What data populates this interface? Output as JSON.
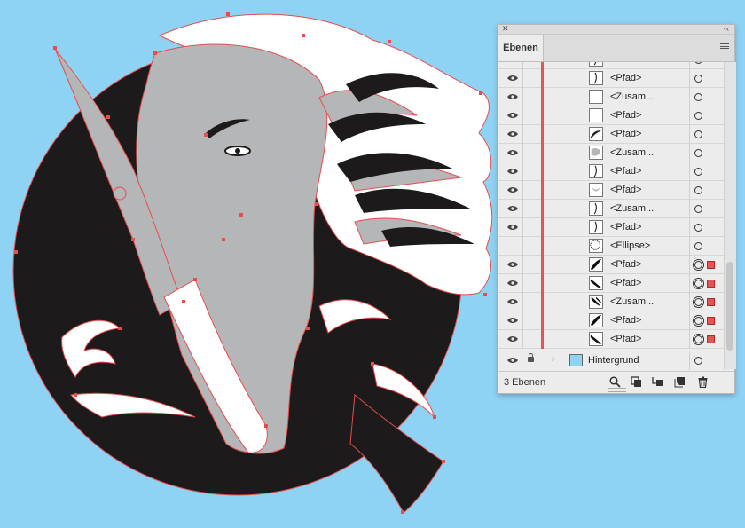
{
  "panel": {
    "tab_label": "Ebenen",
    "footer_label": "3 Ebenen"
  },
  "layers": [
    {
      "label": "<Pfad>",
      "thumb": "stroke-curve",
      "target": "single",
      "selected": false
    },
    {
      "label": "<Pfad>",
      "thumb": "stroke-curve",
      "target": "single",
      "selected": false
    },
    {
      "label": "<Zusam...",
      "thumb": "blank",
      "target": "single",
      "selected": false
    },
    {
      "label": "<Pfad>",
      "thumb": "blank",
      "target": "single",
      "selected": false
    },
    {
      "label": "<Pfad>",
      "thumb": "stroke-swoosh",
      "target": "single",
      "selected": false
    },
    {
      "label": "<Zusam...",
      "thumb": "grey-blob",
      "target": "single",
      "selected": false
    },
    {
      "label": "<Pfad>",
      "thumb": "stroke-curve",
      "target": "single",
      "selected": false
    },
    {
      "label": "<Pfad>",
      "thumb": "grey-crescent",
      "target": "single",
      "selected": false
    },
    {
      "label": "<Zusam...",
      "thumb": "stroke-curve",
      "target": "single",
      "selected": false
    },
    {
      "label": "<Pfad>",
      "thumb": "stroke-curve",
      "target": "single",
      "selected": false
    },
    {
      "label": "<Ellipse>",
      "thumb": "ellipse",
      "target": "single",
      "selected": false
    },
    {
      "label": "<Pfad>",
      "thumb": "black-feather",
      "target": "double",
      "selected": true
    },
    {
      "label": "<Pfad>",
      "thumb": "black-wave",
      "target": "double",
      "selected": true
    },
    {
      "label": "<Zusam...",
      "thumb": "black-hair",
      "target": "double",
      "selected": true
    },
    {
      "label": "<Pfad>",
      "thumb": "black-feather",
      "target": "double",
      "selected": true
    },
    {
      "label": "<Pfad>",
      "thumb": "black-wave",
      "target": "double",
      "selected": true
    }
  ],
  "hintergrund": {
    "label": "Hintergrund",
    "swatch_color": "#8fd3f4"
  },
  "colors": {
    "canvas": "#8fd3f4",
    "ink": "#1c1a1b",
    "grey": "#b4b6b8",
    "path_red": "#e84c4c",
    "layer_red": "#e35454"
  },
  "icons": {
    "visibility": "eye-icon",
    "lock": "lock-icon",
    "footer": [
      "search-icon",
      "clipping-mask-icon",
      "new-sublayer-icon",
      "new-layer-icon",
      "trash-icon"
    ]
  }
}
